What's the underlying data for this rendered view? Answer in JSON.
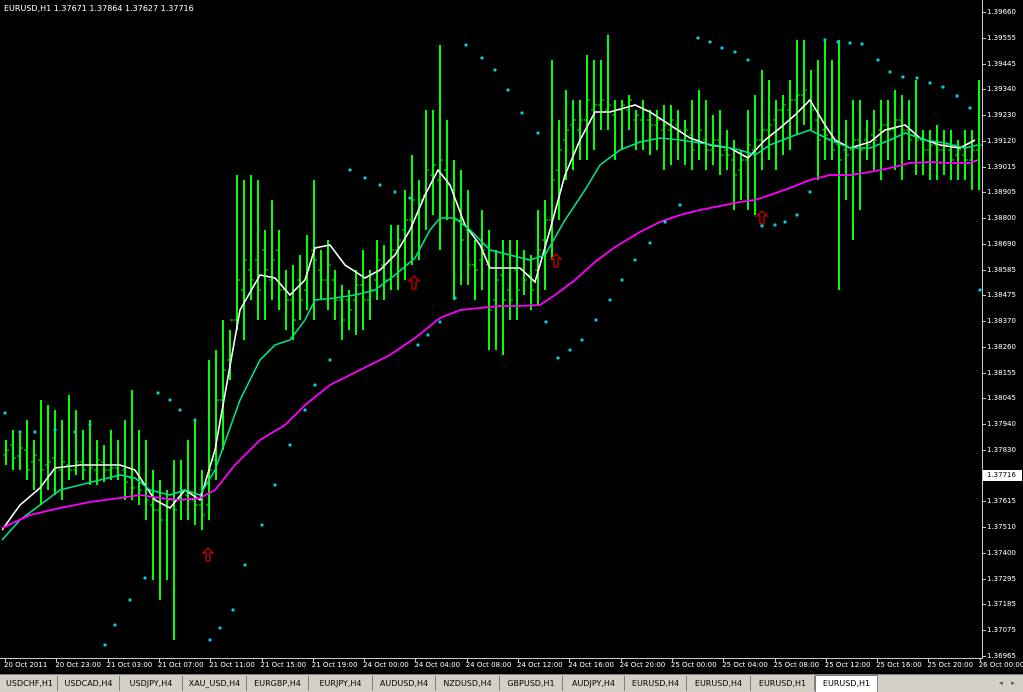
{
  "chart": {
    "info_text": "EURUSD,H1  1.37671 1.37864 1.37627 1.37716",
    "current_price": "1.37716",
    "price_labels": [
      "1.39660",
      "1.39555",
      "1.39445",
      "1.39340",
      "1.39230",
      "1.39120",
      "1.39015",
      "1.38905",
      "1.38800",
      "1.38690",
      "1.38585",
      "1.38475",
      "1.38370",
      "1.38260",
      "1.38155",
      "1.38045",
      "1.37940",
      "1.37830",
      "1.37615",
      "1.37510",
      "1.37400",
      "1.37295",
      "1.37185",
      "1.37075",
      "1.36965"
    ],
    "time_labels": [
      "20 Oct 2011",
      "20 Oct 23:00",
      "21 Oct 03:00",
      "21 Oct 07:00",
      "21 Oct 11:00",
      "21 Oct 15:00",
      "21 Oct 19:00",
      "24 Oct 00:00",
      "24 Oct 04:00",
      "24 Oct 08:00",
      "24 Oct 12:00",
      "24 Oct 16:00",
      "24 Oct 20:00",
      "25 Oct 00:00",
      "25 Oct 04:00",
      "25 Oct 08:00",
      "25 Oct 12:00",
      "25 Oct 16:00",
      "25 Oct 20:00",
      "26 Oct 00:00"
    ],
    "colors": {
      "bars": "#00ff00",
      "ma_fast": "#ffffff",
      "ma_mid": "#00e08c",
      "ma_slow": "#ff00ff",
      "sar": "#00d0e0",
      "arrow": "#cc0000"
    }
  },
  "tabs": [
    "USDCHF,H1",
    "USDCAD,H4",
    "USDJPY,H4",
    "XAU_USD,H4",
    "EURGBP,H4",
    "EURJPY,H4",
    "AUDUSD,H4",
    "NZDUSD,H4",
    "GBPUSD,H1",
    "AUDJPY,H4",
    "EURUSD,H4",
    "EURUSD,H4",
    "EURUSD,H1",
    "EURUSD,H1"
  ],
  "active_tab_index": 13,
  "nav": {
    "left": "◂",
    "right": "▸"
  }
}
